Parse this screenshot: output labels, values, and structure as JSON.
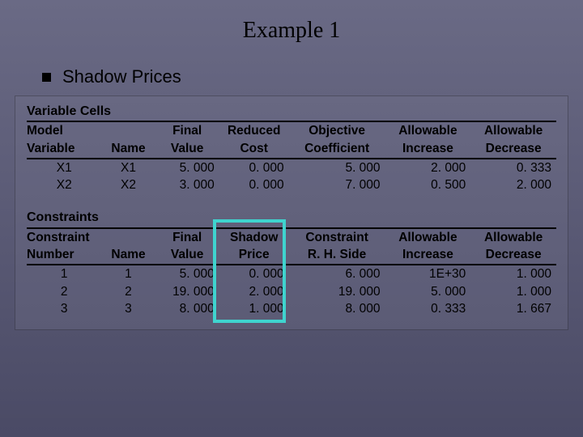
{
  "title": "Example 1",
  "subtitle": "Shadow Prices",
  "tables": {
    "varcells": {
      "section": "Variable Cells",
      "headers": {
        "c0a": "Model",
        "c0b": "Variable",
        "c1a": "",
        "c1b": "Name",
        "c2a": "Final",
        "c2b": "Value",
        "c3a": "Reduced",
        "c3b": "Cost",
        "c4a": "Objective",
        "c4b": "Coefficient",
        "c5a": "Allowable",
        "c5b": "Increase",
        "c6a": "Allowable",
        "c6b": "Decrease"
      },
      "rows": [
        {
          "c0": "X1",
          "c1": "X1",
          "c2": "5. 000",
          "c3": "0. 000",
          "c4": "5. 000",
          "c5": "2. 000",
          "c6": "0. 333"
        },
        {
          "c0": "X2",
          "c1": "X2",
          "c2": "3. 000",
          "c3": "0. 000",
          "c4": "7. 000",
          "c5": "0. 500",
          "c6": "2. 000"
        }
      ]
    },
    "constraints": {
      "section": "Constraints",
      "headers": {
        "c0a": "Constraint",
        "c0b": "Number",
        "c1a": "",
        "c1b": "Name",
        "c2a": "Final",
        "c2b": "Value",
        "c3a": "Shadow",
        "c3b": "Price",
        "c4a": "Constraint",
        "c4b": "R. H. Side",
        "c5a": "Allowable",
        "c5b": "Increase",
        "c6a": "Allowable",
        "c6b": "Decrease"
      },
      "rows": [
        {
          "c0": "1",
          "c1": "1",
          "c2": "5. 000",
          "c3": "0. 000",
          "c4": "6. 000",
          "c5": "1E+30",
          "c6": "1. 000"
        },
        {
          "c0": "2",
          "c1": "2",
          "c2": "19. 000",
          "c3": "2. 000",
          "c4": "19. 000",
          "c5": "5. 000",
          "c6": "1. 000"
        },
        {
          "c0": "3",
          "c1": "3",
          "c2": "8. 000",
          "c3": "1. 000",
          "c4": "8. 000",
          "c5": "0. 333",
          "c6": "1. 667"
        }
      ]
    }
  },
  "chart_data": {
    "type": "table",
    "title": "Example 1 — Shadow Prices (LP Sensitivity Report)",
    "variable_cells": [
      {
        "model_variable": "X1",
        "name": "X1",
        "final_value": 5.0,
        "reduced_cost": 0.0,
        "objective_coefficient": 5.0,
        "allowable_increase": 2.0,
        "allowable_decrease": 0.333
      },
      {
        "model_variable": "X2",
        "name": "X2",
        "final_value": 3.0,
        "reduced_cost": 0.0,
        "objective_coefficient": 7.0,
        "allowable_increase": 0.5,
        "allowable_decrease": 2.0
      }
    ],
    "constraints": [
      {
        "constraint_number": 1,
        "name": "1",
        "final_value": 5.0,
        "shadow_price": 0.0,
        "rhs": 6.0,
        "allowable_increase": "1E+30",
        "allowable_decrease": 1.0
      },
      {
        "constraint_number": 2,
        "name": "2",
        "final_value": 19.0,
        "shadow_price": 2.0,
        "rhs": 19.0,
        "allowable_increase": 5.0,
        "allowable_decrease": 1.0
      },
      {
        "constraint_number": 3,
        "name": "3",
        "final_value": 8.0,
        "shadow_price": 1.0,
        "rhs": 8.0,
        "allowable_increase": 0.333,
        "allowable_decrease": 1.667
      }
    ],
    "highlighted_column": "shadow_price"
  }
}
